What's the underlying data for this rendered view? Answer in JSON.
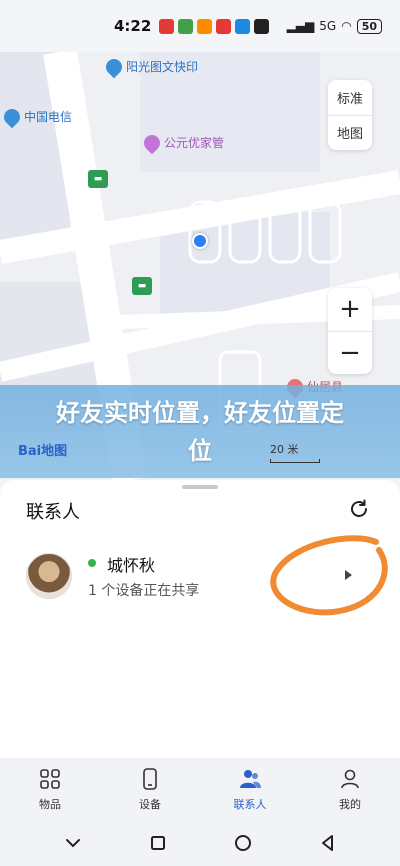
{
  "status_bar": {
    "time": "4:22",
    "network": "5G",
    "battery": "50",
    "app_icons": [
      "#e53935",
      "#43a047",
      "#fb8c00",
      "#e53935",
      "#1e88e5",
      "#222222"
    ]
  },
  "map": {
    "poi_print": "阳光图文快印",
    "poi_telecom": "中国电信",
    "poi_store": "公元优家管",
    "poi_partial": "仙居县",
    "toggle_standard": "标准",
    "toggle_map": "地图",
    "zoom_in": "+",
    "zoom_out": "−",
    "logo": "Bai地图",
    "scale_label": "20 米"
  },
  "banner": {
    "text": "好友实时位置，好友位置定位"
  },
  "sheet": {
    "title": "联系人",
    "contact": {
      "name": "城怀秋",
      "status": "1 个设备正在共享",
      "online": true
    }
  },
  "bottom_nav": {
    "items": [
      {
        "label": "物品",
        "icon": "grid-icon"
      },
      {
        "label": "设备",
        "icon": "phone-icon"
      },
      {
        "label": "联系人",
        "icon": "people-icon",
        "active": true
      },
      {
        "label": "我的",
        "icon": "person-icon"
      }
    ]
  },
  "colors": {
    "accent": "#2b62c9",
    "online": "#36b24a",
    "annotation": "#f08a33",
    "user_dot": "#2b7ef5"
  }
}
